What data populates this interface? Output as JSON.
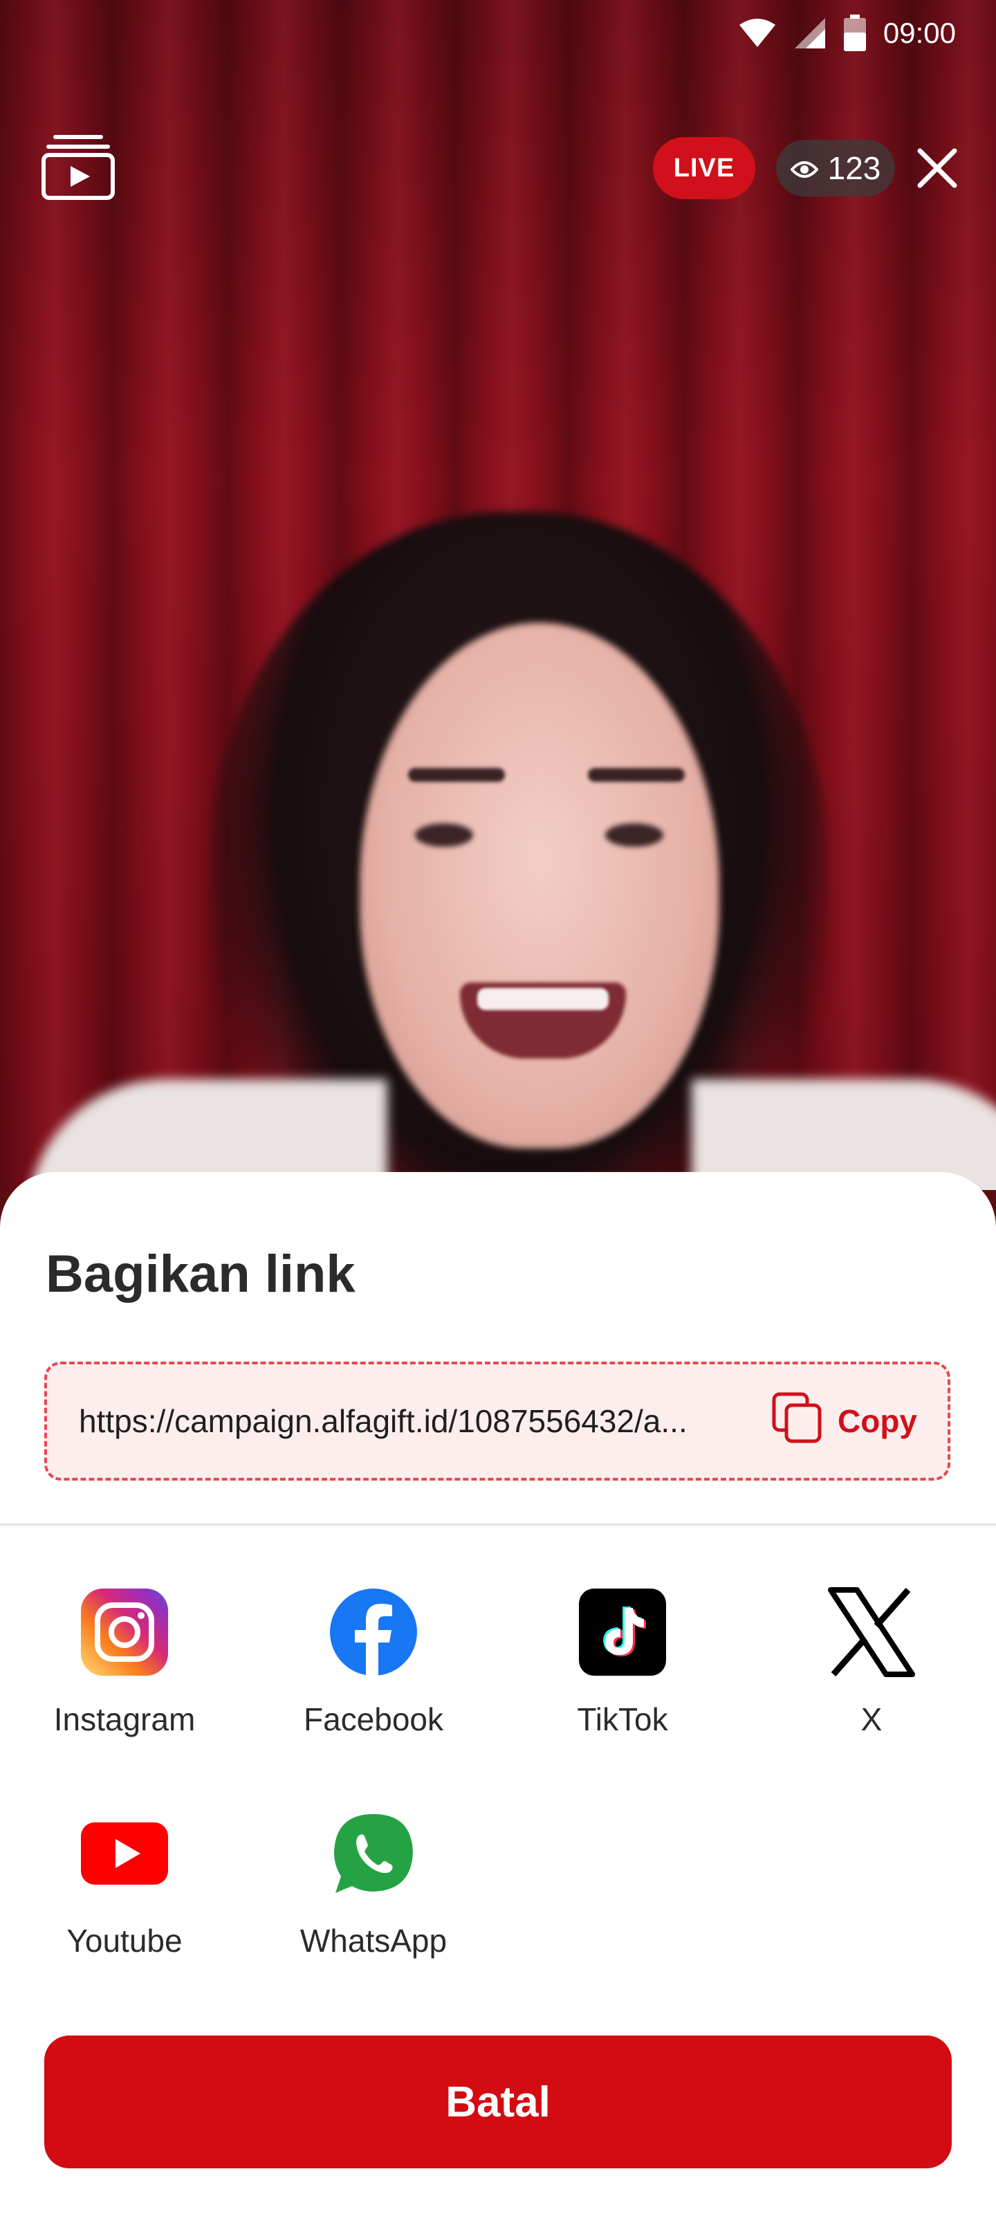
{
  "status_bar": {
    "time": "09:00",
    "icons": [
      "wifi-icon",
      "cellular-signal-icon",
      "battery-icon"
    ]
  },
  "video_overlay": {
    "left_icon": "video-playlist-icon",
    "live_label": "LIVE",
    "viewer_icon": "eye-icon",
    "viewer_count": "123",
    "close_icon": "close-icon"
  },
  "share_sheet": {
    "title": "Bagikan link",
    "link": {
      "url_display": "https://campaign.alfagift.id/1087556432/a...",
      "copy_label": "Copy",
      "copy_icon": "copy-icon"
    },
    "apps": [
      {
        "label": "Instagram",
        "icon": "instagram-icon"
      },
      {
        "label": "Facebook",
        "icon": "facebook-icon"
      },
      {
        "label": "TikTok",
        "icon": "tiktok-icon"
      },
      {
        "label": "X",
        "icon": "x-icon"
      },
      {
        "label": "Youtube",
        "icon": "youtube-icon"
      },
      {
        "label": "WhatsApp",
        "icon": "whatsapp-icon"
      }
    ],
    "cancel_label": "Batal"
  },
  "colors": {
    "brand_red": "#d20c12",
    "link_border": "#e8474f",
    "link_bg": "#fdeeee"
  }
}
